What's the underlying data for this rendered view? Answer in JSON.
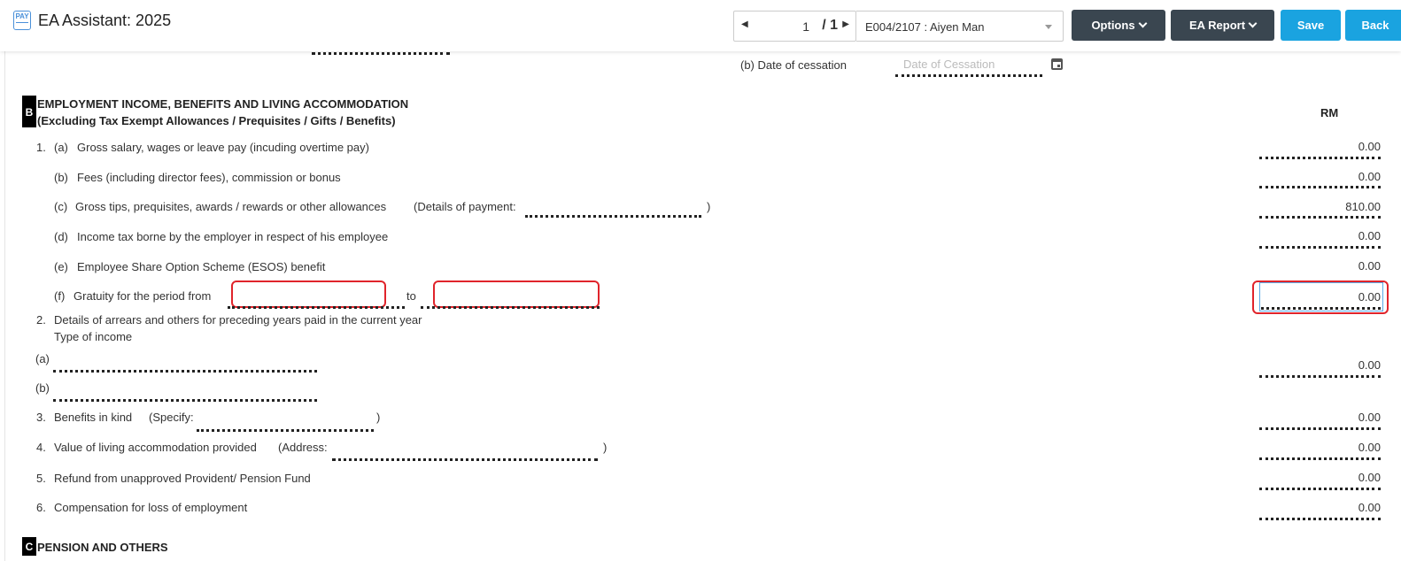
{
  "header": {
    "logo_text": "PAY",
    "title": "EA Assistant: 2025",
    "pager": {
      "current": "1",
      "total": "/ 1"
    },
    "employee": "E004/2107 : Aiyen Man",
    "buttons": {
      "options": "Options",
      "ea_report": "EA Report",
      "save": "Save",
      "back": "Back"
    }
  },
  "cessation": {
    "label": "(b)  Date of cessation",
    "placeholder": "Date of Cessation"
  },
  "section_b": {
    "letter": "B",
    "title_line1": "EMPLOYMENT INCOME, BENEFITS AND LIVING ACCOMMODATION",
    "title_line2": "(Excluding Tax Exempt Allowances / Prequisites / Gifts / Benefits)",
    "currency": "RM",
    "items": [
      {
        "num": "1.",
        "sub": "(a)",
        "label": "Gross salary, wages or leave pay (incuding overtime pay)",
        "amount": "0.00"
      },
      {
        "sub": "(b)",
        "label": "Fees (including director fees), commission or bonus",
        "amount": "0.00"
      },
      {
        "sub": "(c)",
        "label": "Gross tips, prequisites, awards / rewards or other allowances",
        "detail_label": "(Details of payment:",
        "detail_close": ")",
        "amount": "810.00"
      },
      {
        "sub": "(d)",
        "label": "Income tax borne by the employer in respect of his employee",
        "amount": "0.00"
      },
      {
        "sub": "(e)",
        "label": "Employee Share Option Scheme (ESOS) benefit",
        "amount": "0.00"
      },
      {
        "sub": "(f)",
        "label": "Gratuity for the period from",
        "to_label": "to",
        "amount": "0.00"
      }
    ],
    "item2": {
      "num": "2.",
      "label": "Details of arrears and others for preceding years paid in the current year",
      "sublabel": "Type of income",
      "a": "(a)",
      "b": "(b)",
      "amount": "0.00"
    },
    "item3": {
      "num": "3.",
      "label": "Benefits in kind",
      "detail_label": "(Specify:",
      "detail_close": ")",
      "amount": "0.00"
    },
    "item4": {
      "num": "4.",
      "label": "Value of living accommodation provided",
      "detail_label": "(Address:",
      "detail_close": ")",
      "amount": "0.00"
    },
    "item5": {
      "num": "5.",
      "label": "Refund from unapproved Provident/ Pension Fund",
      "amount": "0.00"
    },
    "item6": {
      "num": "6.",
      "label": "Compensation for loss of employment",
      "amount": "0.00"
    }
  },
  "section_c": {
    "letter": "C",
    "title": "PENSION AND OTHERS"
  }
}
